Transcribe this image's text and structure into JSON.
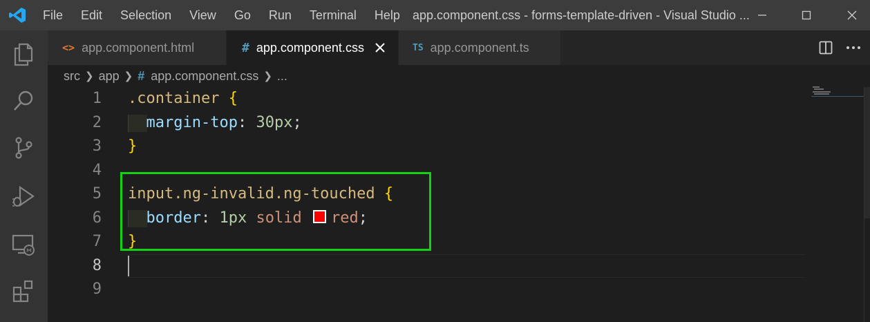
{
  "titlebar": {
    "menu": [
      "File",
      "Edit",
      "Selection",
      "View",
      "Go",
      "Run",
      "Terminal",
      "Help"
    ],
    "window_title": "app.component.css - forms-template-driven - Visual Studio ..."
  },
  "tabs": [
    {
      "icon": "<>",
      "label": "app.component.html"
    },
    {
      "icon": "#",
      "label": "app.component.css"
    },
    {
      "icon": "TS",
      "label": "app.component.ts"
    }
  ],
  "breadcrumb": {
    "items": [
      "src",
      "app",
      "app.component.css",
      "..."
    ],
    "hash": "#"
  },
  "editor": {
    "line_numbers": [
      "1",
      "2",
      "3",
      "4",
      "5",
      "6",
      "7",
      "8",
      "9"
    ],
    "active_line": "8",
    "lines": [
      {
        "selector": ".container",
        "open": "{"
      },
      {
        "property": "margin-top",
        "colon": ":",
        "value": "30px",
        "semi": ";"
      },
      {
        "close": "}"
      },
      {},
      {
        "selector": "input.ng-invalid.ng-touched",
        "open": "{"
      },
      {
        "property": "border",
        "colon": ":",
        "num": "1px",
        "kw": "solid",
        "color": "red",
        "semi": ";"
      },
      {
        "close": "}"
      },
      {},
      {}
    ],
    "swatch_color": "#ff0000",
    "highlight_color": "#11d311"
  }
}
